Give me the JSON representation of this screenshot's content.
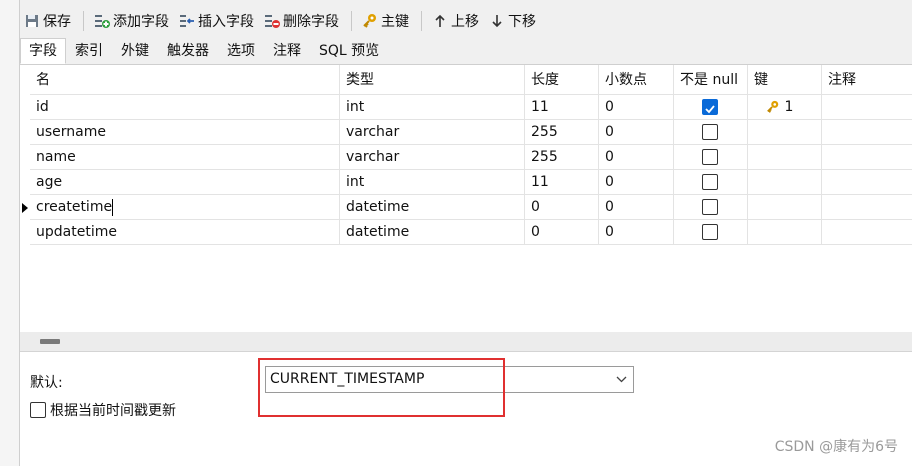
{
  "toolbar": {
    "save": "保存",
    "add_field": "添加字段",
    "insert_field": "插入字段",
    "delete_field": "删除字段",
    "primary_key": "主键",
    "move_up": "上移",
    "move_down": "下移"
  },
  "tabs": [
    "字段",
    "索引",
    "外键",
    "触发器",
    "选项",
    "注释",
    "SQL 预览"
  ],
  "grid": {
    "headers": [
      "名",
      "类型",
      "长度",
      "小数点",
      "不是 null",
      "键",
      "注释"
    ],
    "rows": [
      {
        "name": "id",
        "type": "int",
        "length": "11",
        "decimals": "0",
        "not_null": true,
        "key": "1"
      },
      {
        "name": "username",
        "type": "varchar",
        "length": "255",
        "decimals": "0",
        "not_null": false,
        "key": ""
      },
      {
        "name": "name",
        "type": "varchar",
        "length": "255",
        "decimals": "0",
        "not_null": false,
        "key": ""
      },
      {
        "name": "age",
        "type": "int",
        "length": "11",
        "decimals": "0",
        "not_null": false,
        "key": ""
      },
      {
        "name": "createtime",
        "type": "datetime",
        "length": "0",
        "decimals": "0",
        "not_null": false,
        "key": ""
      },
      {
        "name": "updatetime",
        "type": "datetime",
        "length": "0",
        "decimals": "0",
        "not_null": false,
        "key": ""
      }
    ]
  },
  "properties": {
    "default_label": "默认:",
    "default_value": "CURRENT_TIMESTAMP",
    "on_update_label": "根据当前时间戳更新"
  },
  "watermark": "CSDN @康有为6号",
  "colors": {
    "accent": "#0a6ad8",
    "highlight": "#e03030",
    "key_icon": "#d99a00"
  }
}
